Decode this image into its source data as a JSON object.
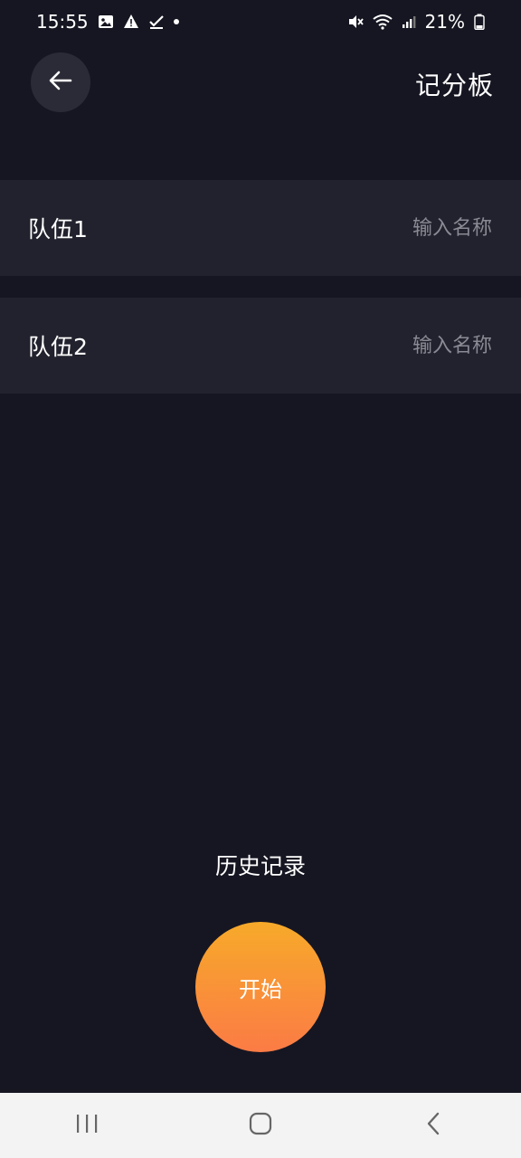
{
  "status_bar": {
    "time": "15:55",
    "battery": "21%",
    "left_icons": [
      "image-icon",
      "alert-icon",
      "check-icon",
      "dot-icon"
    ],
    "right_icons": [
      "mute-icon",
      "wifi-icon",
      "signal-icon",
      "battery-icon"
    ]
  },
  "header": {
    "title": "记分板",
    "back_icon": "arrow-left-icon"
  },
  "teams": [
    {
      "label": "队伍1",
      "placeholder": "输入名称",
      "value": ""
    },
    {
      "label": "队伍2",
      "placeholder": "输入名称",
      "value": ""
    }
  ],
  "history": {
    "label": "历史记录"
  },
  "start": {
    "label": "开始"
  },
  "colors": {
    "background": "#161622",
    "row_background": "#22222e",
    "placeholder": "#8a8a94",
    "accent_top": "#f7aa2a",
    "accent_bottom": "#fb7b45"
  },
  "nav_bar": {
    "icons": [
      "recent-apps-icon",
      "home-icon",
      "back-icon"
    ]
  }
}
